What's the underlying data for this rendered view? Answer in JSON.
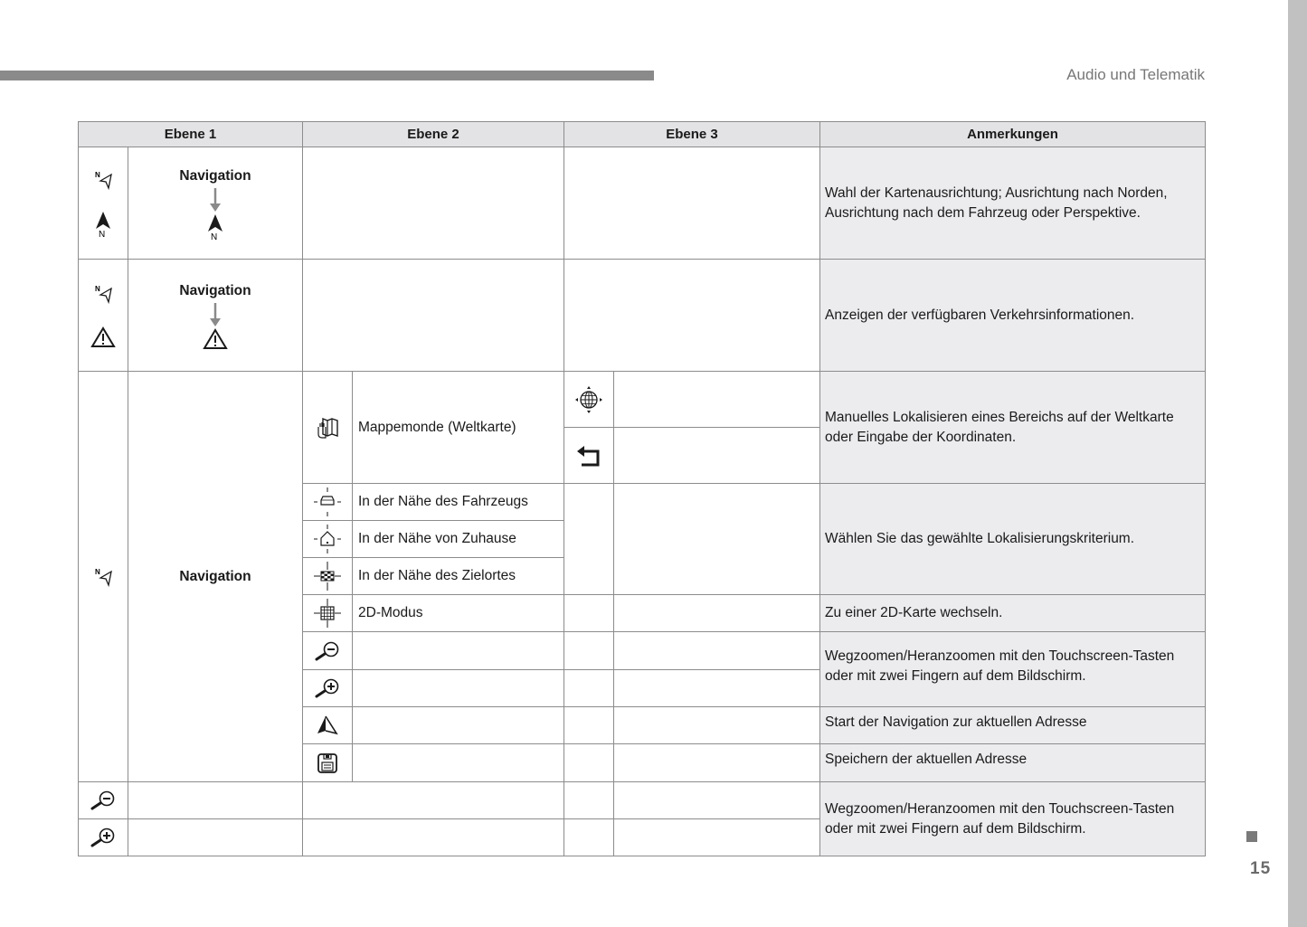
{
  "page": {
    "section_title": "Audio und Telematik",
    "page_number": "15"
  },
  "table": {
    "headers": [
      "Ebene 1",
      "Ebene 2",
      "Ebene 3",
      "Anmerkungen"
    ],
    "rows": [
      {
        "level1_icons": [
          "map-orientation-icon",
          "north-arrow-icon"
        ],
        "level1_label": "Navigation",
        "level1_result_icon": "north-arrow-icon",
        "note": "Wahl der Kartenausrichtung; Ausrichtung nach Norden, Ausrichtung nach dem Fahrzeug oder Perspektive."
      },
      {
        "level1_icons": [
          "map-orientation-icon",
          "warning-triangle-icon"
        ],
        "level1_label": "Navigation",
        "level1_result_icon": "warning-triangle-icon",
        "note": "Anzeigen der verfügbaren Verkehrsinformationen."
      },
      {
        "level1_icons": [
          "map-orientation-icon"
        ],
        "level1_label": "Navigation",
        "sub_items": [
          {
            "icon": "world-map-hand-icon",
            "label": "Mappemonde (Weltkarte)",
            "level3_icons": [
              "globe-move-icon",
              "back-arrow-icon"
            ],
            "note": "Manuelles Lokalisieren eines Bereichs auf der Weltkarte oder Eingabe der Koordinaten."
          },
          {
            "icon": "near-vehicle-icon",
            "label": "In der Nähe des Fahrzeugs"
          },
          {
            "icon": "near-home-icon",
            "label": "In der Nähe von Zuhause"
          },
          {
            "icon": "near-destination-icon",
            "label": "In der Nähe des Zielortes"
          },
          {
            "icon": "2d-grid-icon",
            "label": "2D-Modus",
            "note": "Zu einer 2D-Karte wechseln."
          },
          {
            "icon": "zoom-out-icon",
            "label": ""
          },
          {
            "icon": "zoom-in-icon",
            "label": ""
          },
          {
            "icon": "navigate-arrow-icon",
            "label": "",
            "note": "Start der Navigation zur aktuellen Adresse"
          },
          {
            "icon": "save-disk-icon",
            "label": "",
            "note": "Speichern der aktuellen Adresse"
          }
        ],
        "proximity_note": "Wählen Sie das gewählte Lokalisierungskriterium.",
        "zoom_note": "Wegzoomen/Heranzoomen mit den Touchscreen-Tasten oder mit zwei Fingern auf dem Bildschirm."
      },
      {
        "level1_icons": [
          "zoom-out-icon",
          "zoom-in-icon"
        ],
        "note": "Wegzoomen/Heranzoomen mit den Touchscreen-Tasten oder mit zwei Fingern auf dem Bildschirm."
      }
    ]
  },
  "colors": {
    "header_bg": "#e3e3e6",
    "note_bg": "#ececef",
    "border": "#8c8c8c",
    "arrow": "#8a8a8a"
  }
}
